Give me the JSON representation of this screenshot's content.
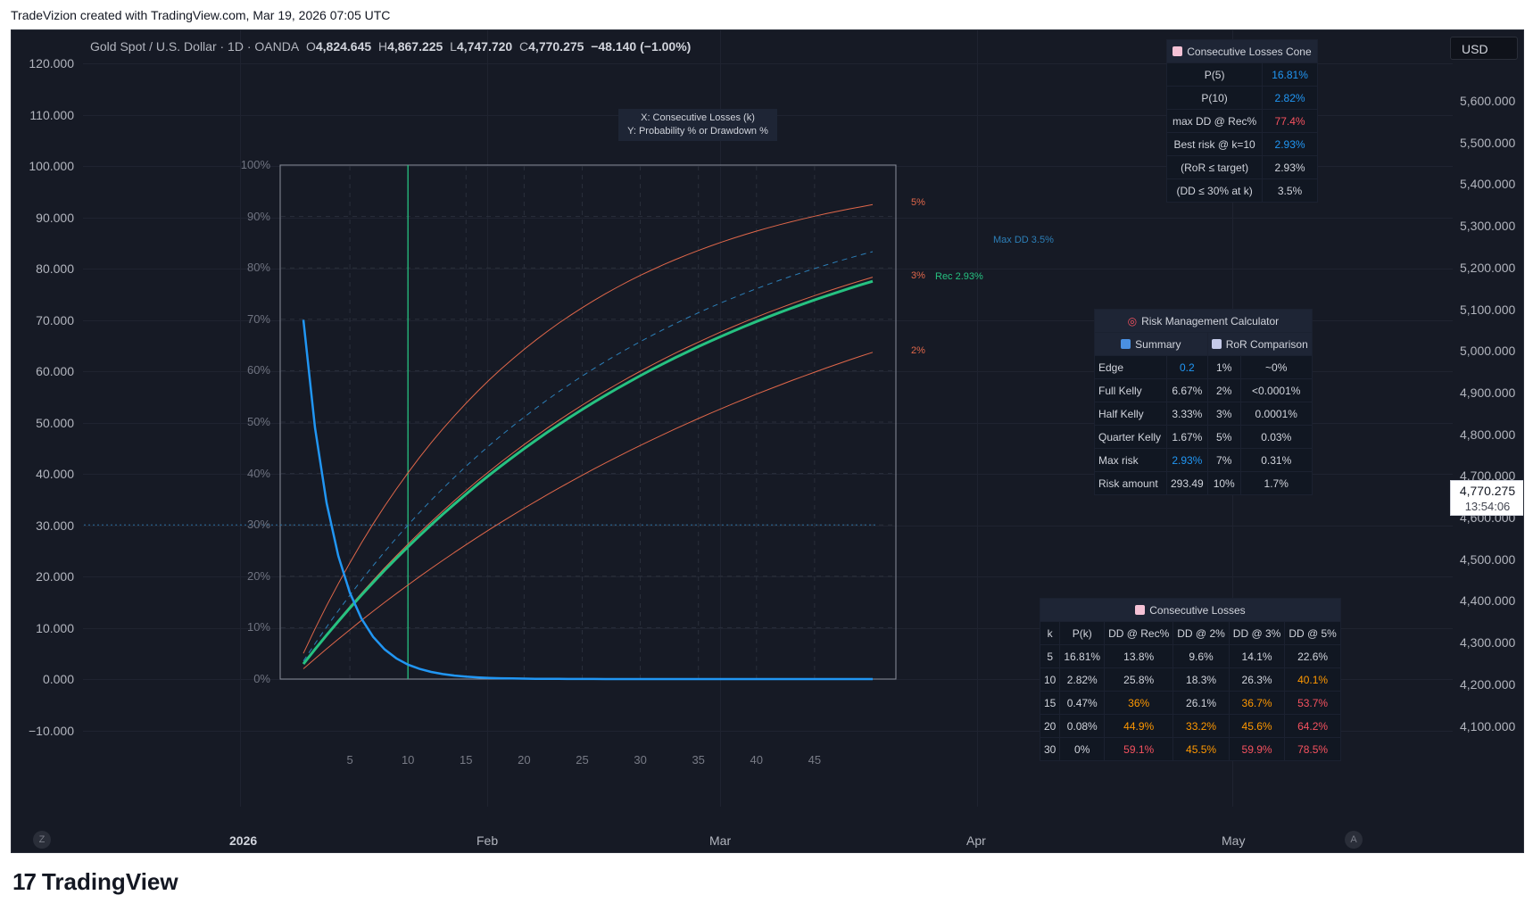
{
  "header": {
    "caption": "TradeVizion created with TradingView.com, Mar 19, 2026 07:05 UTC"
  },
  "legend": {
    "symbol": "Gold Spot / U.S. Dollar · 1D · OANDA",
    "o_label": "O",
    "o": "4,824.645",
    "h_label": "H",
    "h": "4,867.225",
    "l_label": "L",
    "l": "4,747.720",
    "c_label": "C",
    "c": "4,770.275",
    "change": "−48.140 (−1.00%)"
  },
  "left_axis": [
    "120.000",
    "110.000",
    "100.000",
    "90.000",
    "80.000",
    "70.000",
    "60.000",
    "50.000",
    "40.000",
    "30.000",
    "20.000",
    "10.000",
    "0.000",
    "−10.000"
  ],
  "right_axis": [
    "5,600.000",
    "5,500.000",
    "5,400.000",
    "5,300.000",
    "5,200.000",
    "5,100.000",
    "5,000.000",
    "4,900.000",
    "4,800.000",
    "4,700.000",
    "4,600.000",
    "4,500.000",
    "4,400.000",
    "4,300.000",
    "4,200.000",
    "4,100.000"
  ],
  "time_axis": [
    "2026",
    "Feb",
    "Mar",
    "Apr",
    "May"
  ],
  "currency_button": "USD",
  "last_price": {
    "price": "4,770.275",
    "countdown": "13:54:06"
  },
  "scale_buttons": {
    "left": "Z",
    "right": "A"
  },
  "axis_caption": {
    "line1": "X: Consecutive Losses (k)",
    "line2": "Y: Probability % or Drawdown %"
  },
  "colors": {
    "prob": "#2196f3",
    "rec": "#26c281",
    "risk": "#e0674a",
    "maxdd": "#2c7fb8",
    "cursor": "#26c281"
  },
  "chart_data": {
    "type": "line",
    "x_label": "X: Consecutive Losses (k)",
    "y_label": "Y: Probability % or Drawdown %",
    "x_ticks": [
      5,
      10,
      15,
      20,
      25,
      30,
      35,
      40,
      45
    ],
    "y_ticks": [
      "0%",
      "10%",
      "20%",
      "30%",
      "40%",
      "50%",
      "60%",
      "70%",
      "80%",
      "90%",
      "100%"
    ],
    "ylim": [
      0,
      100
    ],
    "xlim": [
      -1,
      52
    ],
    "k_cursor": 10,
    "dd_threshold": 30,
    "series": [
      {
        "name": "5%",
        "kind": "risk",
        "rate": 0.05
      },
      {
        "name": "3%",
        "kind": "risk",
        "rate": 0.03
      },
      {
        "name": "2%",
        "kind": "risk",
        "rate": 0.02
      },
      {
        "name": "Rec 2.93%",
        "kind": "rec",
        "rate": 0.0293
      },
      {
        "name": "Max DD 3.5%",
        "kind": "maxdd",
        "rate": 0.035
      },
      {
        "name": "P(k)",
        "kind": "prob",
        "base": 0.7,
        "p1": 69.9
      }
    ],
    "k_range": [
      1,
      50
    ]
  },
  "cone_panel": {
    "title": "Consecutive Losses Cone",
    "rows": [
      {
        "label": "P(5)",
        "value": "16.81%",
        "color": "blue"
      },
      {
        "label": "P(10)",
        "value": "2.82%",
        "color": "blue"
      },
      {
        "label": "max DD @ Rec%",
        "value": "77.4%",
        "color": "red"
      },
      {
        "label": "Best risk @ k=10",
        "value": "2.93%",
        "color": "blue"
      },
      {
        "label": "(RoR ≤ target)",
        "value": "2.93%",
        "color": ""
      },
      {
        "label": "(DD ≤ 30% at k)",
        "value": "3.5%",
        "color": ""
      }
    ]
  },
  "risk_panel": {
    "title": "Risk Management Calculator",
    "summary_header": "Summary",
    "ror_header": "RoR Comparison",
    "rows": [
      {
        "label": "Edge",
        "value": "0.2",
        "vcolor": "blue",
        "risk": "1%",
        "ror": "~0%"
      },
      {
        "label": "Full Kelly",
        "value": "6.67%",
        "vcolor": "",
        "risk": "2%",
        "ror": "<0.0001%"
      },
      {
        "label": "Half Kelly",
        "value": "3.33%",
        "vcolor": "",
        "risk": "3%",
        "ror": "0.0001%"
      },
      {
        "label": "Quarter Kelly",
        "value": "1.67%",
        "vcolor": "",
        "risk": "5%",
        "ror": "0.03%"
      },
      {
        "label": "Max risk",
        "value": "2.93%",
        "vcolor": "blue",
        "risk": "7%",
        "ror": "0.31%"
      },
      {
        "label": "Risk amount",
        "value": "293.49",
        "vcolor": "",
        "risk": "10%",
        "ror": "1.7%"
      }
    ]
  },
  "losses_panel": {
    "title": "Consecutive Losses",
    "columns": [
      "k",
      "P(k)",
      "DD @ Rec%",
      "DD @ 2%",
      "DD @ 3%",
      "DD @ 5%"
    ],
    "rows": [
      {
        "cells": [
          "5",
          "16.81%",
          "13.8%",
          "9.6%",
          "14.1%",
          "22.6%"
        ],
        "colors": [
          "",
          "",
          "",
          "",
          "",
          ""
        ]
      },
      {
        "cells": [
          "10",
          "2.82%",
          "25.8%",
          "18.3%",
          "26.3%",
          "40.1%"
        ],
        "colors": [
          "",
          "",
          "",
          "",
          "",
          "orange"
        ]
      },
      {
        "cells": [
          "15",
          "0.47%",
          "36%",
          "26.1%",
          "36.7%",
          "53.7%"
        ],
        "colors": [
          "",
          "",
          "orange",
          "",
          "orange",
          "red"
        ]
      },
      {
        "cells": [
          "20",
          "0.08%",
          "44.9%",
          "33.2%",
          "45.6%",
          "64.2%"
        ],
        "colors": [
          "",
          "",
          "orange",
          "orange",
          "orange",
          "red"
        ]
      },
      {
        "cells": [
          "30",
          "0%",
          "59.1%",
          "45.5%",
          "59.9%",
          "78.5%"
        ],
        "colors": [
          "",
          "",
          "red",
          "orange",
          "red",
          "red"
        ]
      }
    ]
  },
  "brand": {
    "name": "TradingView",
    "logo": "17"
  }
}
